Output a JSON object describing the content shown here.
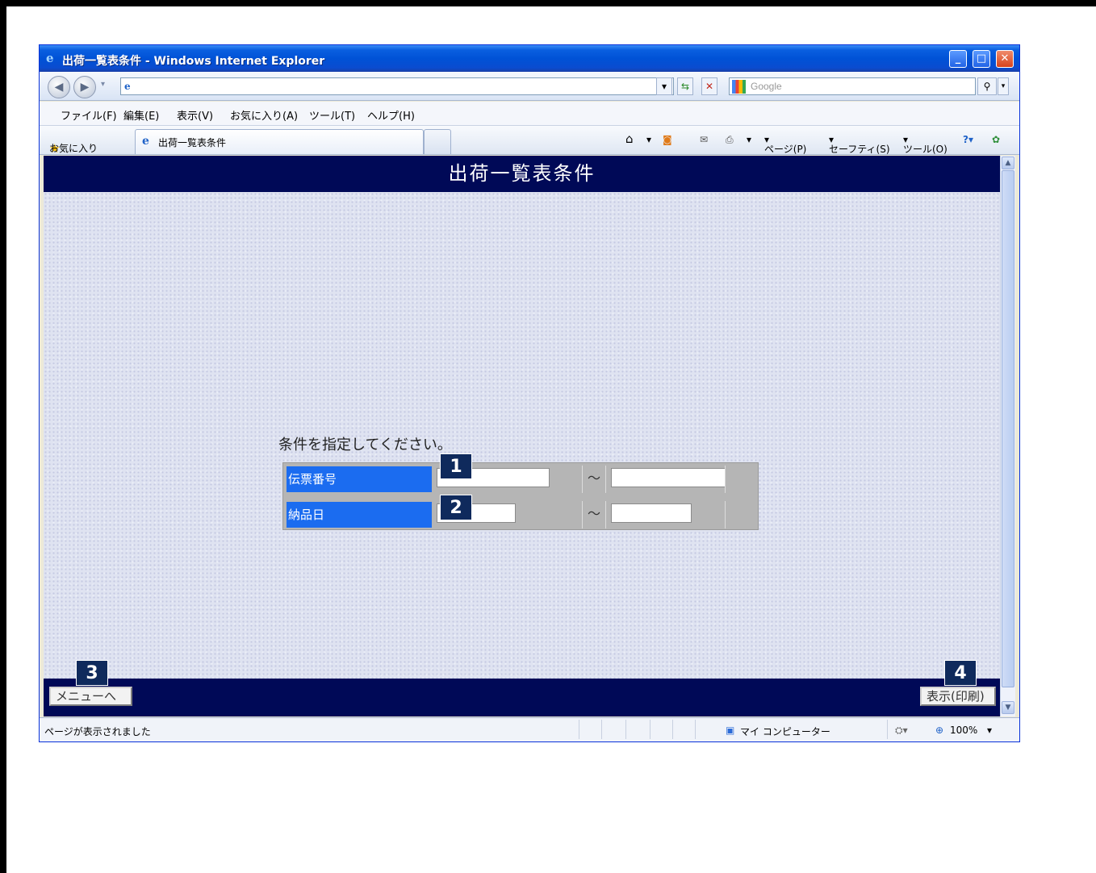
{
  "window": {
    "title": "出荷一覧表条件 - Windows Internet Explorer",
    "minimize_glyph": "_",
    "maximize_glyph": "□",
    "close_glyph": "✕"
  },
  "address_bar": {
    "url": "",
    "search_placeholder": "Google"
  },
  "menu": [
    "ファイル(F)",
    "編集(E)",
    "表示(V)",
    "お気に入り(A)",
    "ツール(T)",
    "ヘルプ(H)"
  ],
  "favorites_label": "お気に入り",
  "tab": {
    "label": "出荷一覧表条件"
  },
  "command_bar": {
    "page": "ページ(P)",
    "safety": "セーフティ(S)",
    "tools": "ツール(O)"
  },
  "page": {
    "header_title": "出荷一覧表条件",
    "instruction": "条件を指定してください。",
    "conditions": [
      {
        "label": "伝票番号",
        "from_value": "",
        "to_value": "",
        "separator": "～",
        "badge": "1"
      },
      {
        "label": "納品日",
        "from_value": "",
        "to_value": "",
        "separator": "～",
        "badge": "2"
      }
    ],
    "menu_button": {
      "label": "メニューへ",
      "badge": "3"
    },
    "print_button": {
      "label": "表示(印刷)",
      "badge": "4"
    }
  },
  "status_bar": {
    "message": "ページが表示されました",
    "zone": "マイ コンピューター",
    "zoom": "100%"
  },
  "colors": {
    "header_bg": "#000957",
    "label_bg": "#1b6cf0",
    "badge_bg": "#0f2a5c"
  }
}
